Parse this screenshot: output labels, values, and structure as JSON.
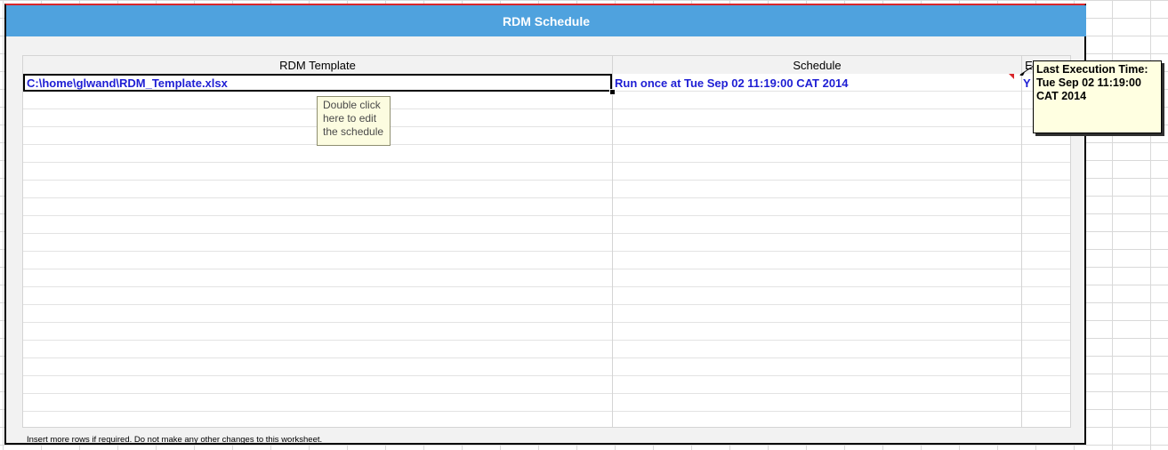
{
  "title": "RDM Schedule",
  "table": {
    "headers": {
      "template": "RDM Template",
      "schedule": "Schedule",
      "enabled": "Enabled"
    },
    "rows": [
      {
        "template": "C:\\home\\glwand\\RDM_Template.xlsx",
        "schedule": "Run once at Tue Sep 02 11:19:00 CAT 2014",
        "enabled": "Y"
      }
    ]
  },
  "tooltip_edit": {
    "line1": "Double click",
    "line2": "here to edit",
    "line3": "the schedule"
  },
  "comment": {
    "line1": "Last Execution Time:",
    "line2": "Tue Sep 02 11:19:00",
    "line3": "CAT 2014"
  },
  "footer_note": "Insert more rows if required. Do not make any other changes to this worksheet.",
  "colors": {
    "title_bar": "#4fa2de",
    "cell_text": "#1e1ed4",
    "comment_marker": "#d9262b",
    "comment_bg": "#ffffe1",
    "tooltip_bg": "#fcfce0"
  }
}
